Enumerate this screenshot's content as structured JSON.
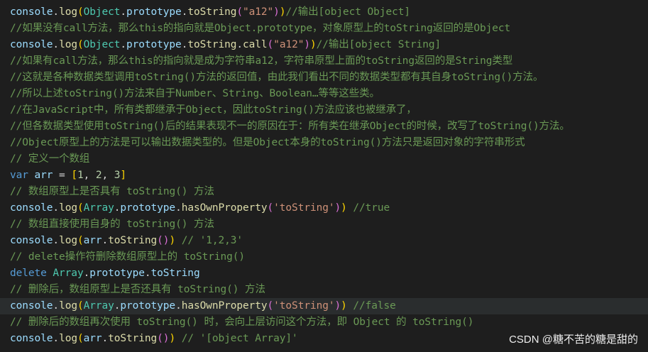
{
  "code": {
    "lines": [
      {
        "tokens": [
          {
            "t": "console",
            "c": "var"
          },
          {
            "t": ".",
            "c": "plain"
          },
          {
            "t": "log",
            "c": "func"
          },
          {
            "t": "(",
            "c": "b1"
          },
          {
            "t": "Object",
            "c": "type"
          },
          {
            "t": ".",
            "c": "plain"
          },
          {
            "t": "prototype",
            "c": "var"
          },
          {
            "t": ".",
            "c": "plain"
          },
          {
            "t": "toString",
            "c": "func"
          },
          {
            "t": "(",
            "c": "b2"
          },
          {
            "t": "\"a12\"",
            "c": "str"
          },
          {
            "t": ")",
            "c": "b2"
          },
          {
            "t": ")",
            "c": "b1"
          },
          {
            "t": "//输出[object Object]",
            "c": "cmt"
          }
        ]
      },
      {
        "tokens": [
          {
            "t": "//如果没有call方法，那么this的指向就是Object.prototype，对象原型上的toString返回的是Object",
            "c": "cmt"
          }
        ]
      },
      {
        "tokens": [
          {
            "t": "console",
            "c": "var"
          },
          {
            "t": ".",
            "c": "plain"
          },
          {
            "t": "log",
            "c": "func"
          },
          {
            "t": "(",
            "c": "b1"
          },
          {
            "t": "Object",
            "c": "type"
          },
          {
            "t": ".",
            "c": "plain"
          },
          {
            "t": "prototype",
            "c": "var"
          },
          {
            "t": ".",
            "c": "plain"
          },
          {
            "t": "toString",
            "c": "func"
          },
          {
            "t": ".",
            "c": "plain"
          },
          {
            "t": "call",
            "c": "func"
          },
          {
            "t": "(",
            "c": "b2"
          },
          {
            "t": "\"a12\"",
            "c": "str"
          },
          {
            "t": ")",
            "c": "b2"
          },
          {
            "t": ")",
            "c": "b1"
          },
          {
            "t": "//输出[object String]",
            "c": "cmt"
          }
        ]
      },
      {
        "tokens": [
          {
            "t": "//如果有call方法，那么this的指向就是成为字符串a12，字符串原型上面的toString返回的是String类型",
            "c": "cmt"
          }
        ]
      },
      {
        "tokens": [
          {
            "t": "//这就是各种数据类型调用toString()方法的返回值，由此我们看出不同的数据类型都有其自身toString()方法。",
            "c": "cmt"
          }
        ]
      },
      {
        "tokens": [
          {
            "t": "//所以上述toString()方法来自于Number、String、Boolean…等等这些类。",
            "c": "cmt"
          }
        ]
      },
      {
        "tokens": [
          {
            "t": "//在JavaScript中，所有类都继承于Object，因此toString()方法应该也被继承了，",
            "c": "cmt"
          }
        ]
      },
      {
        "tokens": [
          {
            "t": "//但各数据类型使用toString()后的结果表现不一的原因在于：所有类在继承Object的时候，改写了toString()方法。",
            "c": "cmt"
          }
        ]
      },
      {
        "tokens": [
          {
            "t": "//Object原型上的方法是可以输出数据类型的。但是Object本身的toString()方法只是返回对象的字符串形式",
            "c": "cmt"
          }
        ]
      },
      {
        "tokens": [
          {
            "t": "// 定义一个数组",
            "c": "cmt"
          }
        ]
      },
      {
        "tokens": [
          {
            "t": "var",
            "c": "kw"
          },
          {
            "t": " ",
            "c": "plain"
          },
          {
            "t": "arr",
            "c": "var"
          },
          {
            "t": " = ",
            "c": "plain"
          },
          {
            "t": "[",
            "c": "b1"
          },
          {
            "t": "1",
            "c": "num"
          },
          {
            "t": ", ",
            "c": "plain"
          },
          {
            "t": "2",
            "c": "num"
          },
          {
            "t": ", ",
            "c": "plain"
          },
          {
            "t": "3",
            "c": "num"
          },
          {
            "t": "]",
            "c": "b1"
          }
        ]
      },
      {
        "tokens": [
          {
            "t": "// 数组原型上是否具有 toString() 方法",
            "c": "cmt"
          }
        ]
      },
      {
        "tokens": [
          {
            "t": "console",
            "c": "var"
          },
          {
            "t": ".",
            "c": "plain"
          },
          {
            "t": "log",
            "c": "func"
          },
          {
            "t": "(",
            "c": "b1"
          },
          {
            "t": "Array",
            "c": "type"
          },
          {
            "t": ".",
            "c": "plain"
          },
          {
            "t": "prototype",
            "c": "var"
          },
          {
            "t": ".",
            "c": "plain"
          },
          {
            "t": "hasOwnProperty",
            "c": "func"
          },
          {
            "t": "(",
            "c": "b2"
          },
          {
            "t": "'toString'",
            "c": "str"
          },
          {
            "t": ")",
            "c": "b2"
          },
          {
            "t": ")",
            "c": "b1"
          },
          {
            "t": " //true",
            "c": "cmt"
          }
        ]
      },
      {
        "tokens": [
          {
            "t": "// 数组直接使用自身的 toString() 方法",
            "c": "cmt"
          }
        ]
      },
      {
        "tokens": [
          {
            "t": "console",
            "c": "var"
          },
          {
            "t": ".",
            "c": "plain"
          },
          {
            "t": "log",
            "c": "func"
          },
          {
            "t": "(",
            "c": "b1"
          },
          {
            "t": "arr",
            "c": "var"
          },
          {
            "t": ".",
            "c": "plain"
          },
          {
            "t": "toString",
            "c": "func"
          },
          {
            "t": "()",
            "c": "b2"
          },
          {
            "t": ")",
            "c": "b1"
          },
          {
            "t": " // '1,2,3'",
            "c": "cmt"
          }
        ]
      },
      {
        "tokens": [
          {
            "t": "// delete操作符删除数组原型上的 toString()",
            "c": "cmt"
          }
        ]
      },
      {
        "tokens": [
          {
            "t": "delete",
            "c": "kw"
          },
          {
            "t": " ",
            "c": "plain"
          },
          {
            "t": "Array",
            "c": "type"
          },
          {
            "t": ".",
            "c": "plain"
          },
          {
            "t": "prototype",
            "c": "var"
          },
          {
            "t": ".",
            "c": "plain"
          },
          {
            "t": "toString",
            "c": "var"
          }
        ]
      },
      {
        "tokens": [
          {
            "t": "// 删除后，数组原型上是否还具有 toString() 方法",
            "c": "cmt"
          }
        ]
      },
      {
        "highlight": true,
        "tokens": [
          {
            "t": "console",
            "c": "var"
          },
          {
            "t": ".",
            "c": "plain"
          },
          {
            "t": "log",
            "c": "func"
          },
          {
            "t": "(",
            "c": "b1"
          },
          {
            "t": "Array",
            "c": "type"
          },
          {
            "t": ".",
            "c": "plain"
          },
          {
            "t": "prototype",
            "c": "var"
          },
          {
            "t": ".",
            "c": "plain"
          },
          {
            "t": "hasOwnProperty",
            "c": "func"
          },
          {
            "t": "(",
            "c": "b2"
          },
          {
            "t": "'toString'",
            "c": "str"
          },
          {
            "t": ")",
            "c": "b2"
          },
          {
            "t": ")",
            "c": "b1"
          },
          {
            "t": " //false",
            "c": "cmt"
          }
        ]
      },
      {
        "tokens": [
          {
            "t": "// 删除后的数组再次使用 toString() 时，会向上层访问这个方法，即 Object 的 toString()",
            "c": "cmt"
          }
        ]
      },
      {
        "tokens": [
          {
            "t": "console",
            "c": "var"
          },
          {
            "t": ".",
            "c": "plain"
          },
          {
            "t": "log",
            "c": "func"
          },
          {
            "t": "(",
            "c": "b1"
          },
          {
            "t": "arr",
            "c": "var"
          },
          {
            "t": ".",
            "c": "plain"
          },
          {
            "t": "toString",
            "c": "func"
          },
          {
            "t": "()",
            "c": "b2"
          },
          {
            "t": ")",
            "c": "b1"
          },
          {
            "t": " // '[object Array]'",
            "c": "cmt"
          }
        ]
      }
    ]
  },
  "watermark": "CSDN @糖不苦的糖是甜的",
  "colors": {
    "background": "#1e1e1e",
    "comment": "#6a9955",
    "string": "#ce9178",
    "keyword": "#569cd6",
    "variable": "#9cdcfe",
    "type": "#4ec9b0",
    "function": "#dcdcaa",
    "number": "#b5cea8",
    "bracket_level1": "#ffd700",
    "bracket_level2": "#da70d6"
  }
}
